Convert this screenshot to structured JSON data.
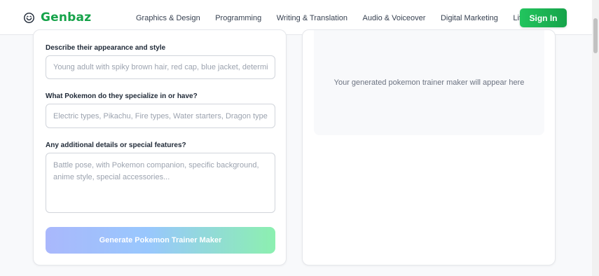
{
  "brand": {
    "name": "Genbaz",
    "color": "#16a34a"
  },
  "nav": {
    "items": [
      {
        "label": "Graphics & Design"
      },
      {
        "label": "Programming"
      },
      {
        "label": "Writing & Translation"
      },
      {
        "label": "Audio & Voiceover"
      },
      {
        "label": "Digital Marketing"
      },
      {
        "label": "Lifestyle"
      }
    ],
    "sign_in": "Sign In"
  },
  "form": {
    "appearance": {
      "label": "Describe their appearance and style",
      "placeholder": "Young adult with spiky brown hair, red cap, blue jacket, determined"
    },
    "specialty": {
      "label": "What Pokemon do they specialize in or have?",
      "placeholder": "Electric types, Pikachu, Fire types, Water starters, Dragon types..."
    },
    "details": {
      "label": "Any additional details or special features?",
      "placeholder": "Battle pose, with Pokemon companion, specific background, anime style, special accessories..."
    },
    "submit_label": "Generate Pokemon Trainer Maker"
  },
  "output": {
    "placeholder": "Your generated pokemon trainer maker will appear here"
  }
}
